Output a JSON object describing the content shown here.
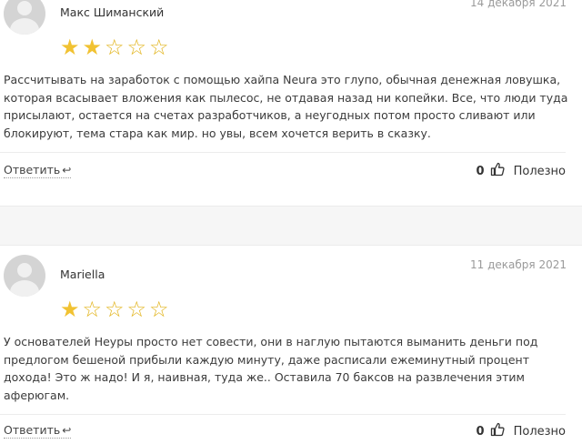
{
  "reviews": [
    {
      "author": "Макс Шиманский",
      "date": "14 декабря 2021",
      "rating": 2,
      "max_rating": 5,
      "text": "Рассчитывать на заработок с помощью хайпа Neura это глупо, обычная денежная ловушка, которая всасывает вложения как пылесос, не отдавая назад ни копейки. Все, что люди туда присылают, остается на счетах разработчиков, а неугодных потом просто сливают или блокируют, тема стара как мир. но увы, всем хочется верить в сказку.",
      "reply_label": "Ответить",
      "likes": "0",
      "useful_label": "Полезно"
    },
    {
      "author": "Mariella",
      "date": "11 декабря 2021",
      "rating": 1,
      "max_rating": 5,
      "text": "У основателей Неуры просто нет совести, они в наглую пытаются выманить деньги под предлогом бешеной прибыли каждую минуту, даже расписали ежеминутный процент дохода! Это ж надо! И я, наивная, туда же.. Оставила 70 баксов на развлечения этим аферюгам.",
      "reply_label": "Ответить",
      "likes": "0",
      "useful_label": "Полезно"
    }
  ],
  "icons": {
    "reply": "reply-arrow-icon",
    "like": "thumbs-up-icon",
    "star_filled": "star-filled-icon",
    "star_empty": "star-empty-icon"
  },
  "colors": {
    "star": "#f1c232",
    "date": "#9a9a9a",
    "separator": "#f6f6f6"
  }
}
